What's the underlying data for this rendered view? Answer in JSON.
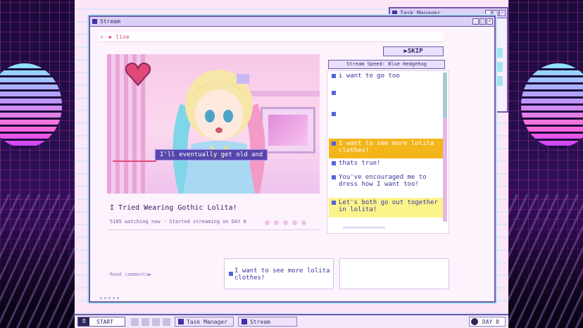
{
  "stream_window": {
    "title": "Stream"
  },
  "task_manager_window": {
    "title": "Task Manager"
  },
  "address_bar": {
    "text": "live"
  },
  "video": {
    "subtitle": "I'll eventually get old and"
  },
  "post": {
    "title": "I Tried Wearing Gothic Lolita!",
    "meta": "5185 watching now - Started streaming on DAY 8"
  },
  "controls": {
    "skip_label": "▶SKIP",
    "stream_speed": "Stream Speed: Blue Hedgehog"
  },
  "chat": {
    "messages": [
      {
        "text": "i want to go too",
        "highlight": "none"
      },
      {
        "text": "",
        "highlight": "none"
      },
      {
        "text": "",
        "highlight": "none"
      },
      {
        "text": "I want to see more lolita clothes!",
        "highlight": "orange"
      },
      {
        "text": "thats true!",
        "highlight": "none"
      },
      {
        "text": "You've encouraged me to dress how I want too!",
        "highlight": "none"
      },
      {
        "text": "Let's both go out together in lolita!",
        "highlight": "yellow"
      }
    ]
  },
  "read_comments": "Read comments▶",
  "comment_boxes": [
    {
      "text": "I want to see more lolita clothes!"
    },
    {
      "text": ""
    }
  ],
  "taskbar": {
    "start_label": "START",
    "tasks": [
      "Task Manager",
      "Stream"
    ],
    "day_label": "DAY 8"
  },
  "colors": {
    "accent": "#6d5aa8",
    "chat_orange": "#f2b51a",
    "chat_yellow": "#fbf48a",
    "live_red": "#e24a7c"
  }
}
